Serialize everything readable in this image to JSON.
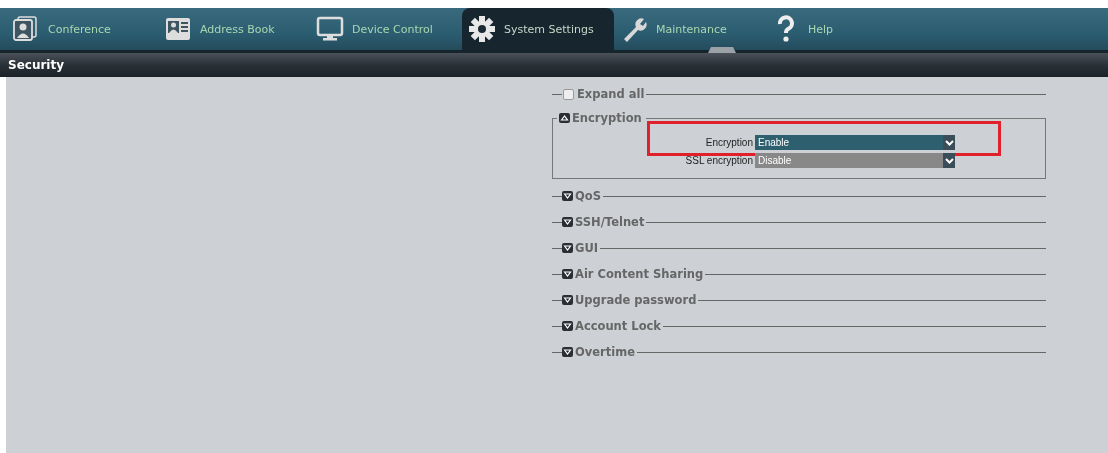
{
  "tabs": [
    {
      "label": "Conference",
      "selected": false
    },
    {
      "label": "Address Book",
      "selected": false
    },
    {
      "label": "Device Control",
      "selected": false
    },
    {
      "label": "System Settings",
      "selected": true
    },
    {
      "label": "Maintenance",
      "selected": false
    },
    {
      "label": "Help",
      "selected": false
    }
  ],
  "page_title": "Security",
  "sections": [
    {
      "kind": "checkbox",
      "label": "Expand all",
      "checked": false
    },
    {
      "kind": "group",
      "label": "Encryption",
      "expanded": true,
      "fields": [
        {
          "label": "Encryption",
          "value": "Enable",
          "active": true,
          "highlighted": true
        },
        {
          "label": "SSL encryption",
          "value": "Disable",
          "active": false,
          "highlighted": false
        }
      ]
    },
    {
      "kind": "group",
      "label": "QoS",
      "expanded": false
    },
    {
      "kind": "group",
      "label": "SSH/Telnet",
      "expanded": false
    },
    {
      "kind": "group",
      "label": "GUI",
      "expanded": false
    },
    {
      "kind": "group",
      "label": "Air Content Sharing",
      "expanded": false
    },
    {
      "kind": "group",
      "label": "Upgrade password",
      "expanded": false
    },
    {
      "kind": "group",
      "label": "Account Lock",
      "expanded": false
    },
    {
      "kind": "group",
      "label": "Overtime",
      "expanded": false
    }
  ]
}
